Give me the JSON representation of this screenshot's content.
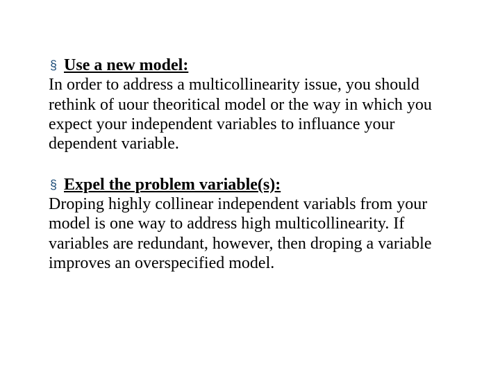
{
  "blocks": [
    {
      "heading": "Use a new model:",
      "body": "In order to address a multicollinearity issue, you should rethink of uour theoritical model or the way in which you expect your independent variables to influance your dependent variable."
    },
    {
      "heading": "Expel the problem variable(s):",
      "body": "Droping highly collinear independent variabls from your model is one way to address high multicollinearity. If variables are redundant, however, then droping a variable improves an overspecified model."
    }
  ],
  "bullet_glyph": "§"
}
